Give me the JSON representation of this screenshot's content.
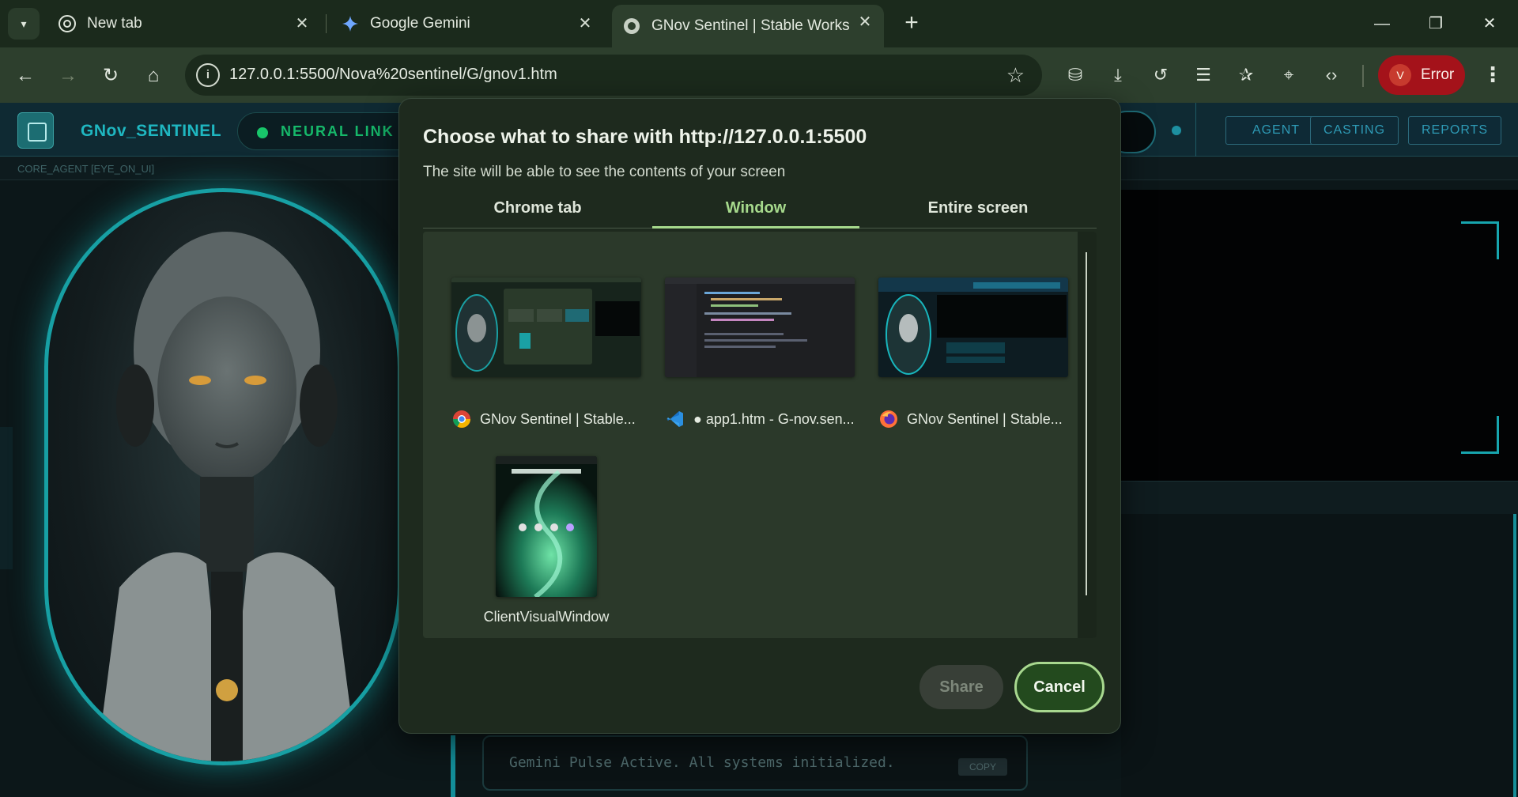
{
  "browser": {
    "tabs": [
      {
        "title": "New tab",
        "icon": "chrome-icon"
      },
      {
        "title": "Google Gemini",
        "icon": "gemini-sparkle-icon"
      },
      {
        "title": "GNov Sentinel | Stable Workspa",
        "icon": "globe-icon",
        "active": true
      }
    ],
    "url": "127.0.0.1:5500/Nova%20sentinel/G/gnov1.htm",
    "profile": {
      "initial": "V",
      "label": "Error",
      "color": "#a4121a"
    },
    "toolbar_icons": [
      "incognito-icon",
      "download-icon",
      "history-icon",
      "reading-list-icon",
      "favorites-icon",
      "location-icon",
      "code-icon"
    ]
  },
  "app": {
    "title": "GNov_SENTINEL",
    "status": "NEURAL LINK A",
    "core_label": "CORE_AGENT [EYE_ON_UI]",
    "nav": [
      "AGENT",
      "CASTING",
      "REPORTS"
    ],
    "log_text": "Gemini Pulse Active. All systems initialized.",
    "copy_label": "COPY",
    "accent": "#17a5ae"
  },
  "dialog": {
    "title": "Choose what to share with http://127.0.0.1:5500",
    "subtitle": "The site will be able to see the contents of your screen",
    "tabs": [
      "Chrome tab",
      "Window",
      "Entire screen"
    ],
    "active_tab": "Window",
    "sources": [
      {
        "label": "GNov Sentinel | Stable...",
        "icon": "chrome-icon"
      },
      {
        "label": "● app1.htm - G-nov.sen...",
        "icon": "vscode-icon"
      },
      {
        "label": "GNov Sentinel | Stable...",
        "icon": "firefox-icon"
      },
      {
        "label": "ClientVisualWindow",
        "icon": ""
      }
    ],
    "share_label": "Share",
    "cancel_label": "Cancel"
  }
}
